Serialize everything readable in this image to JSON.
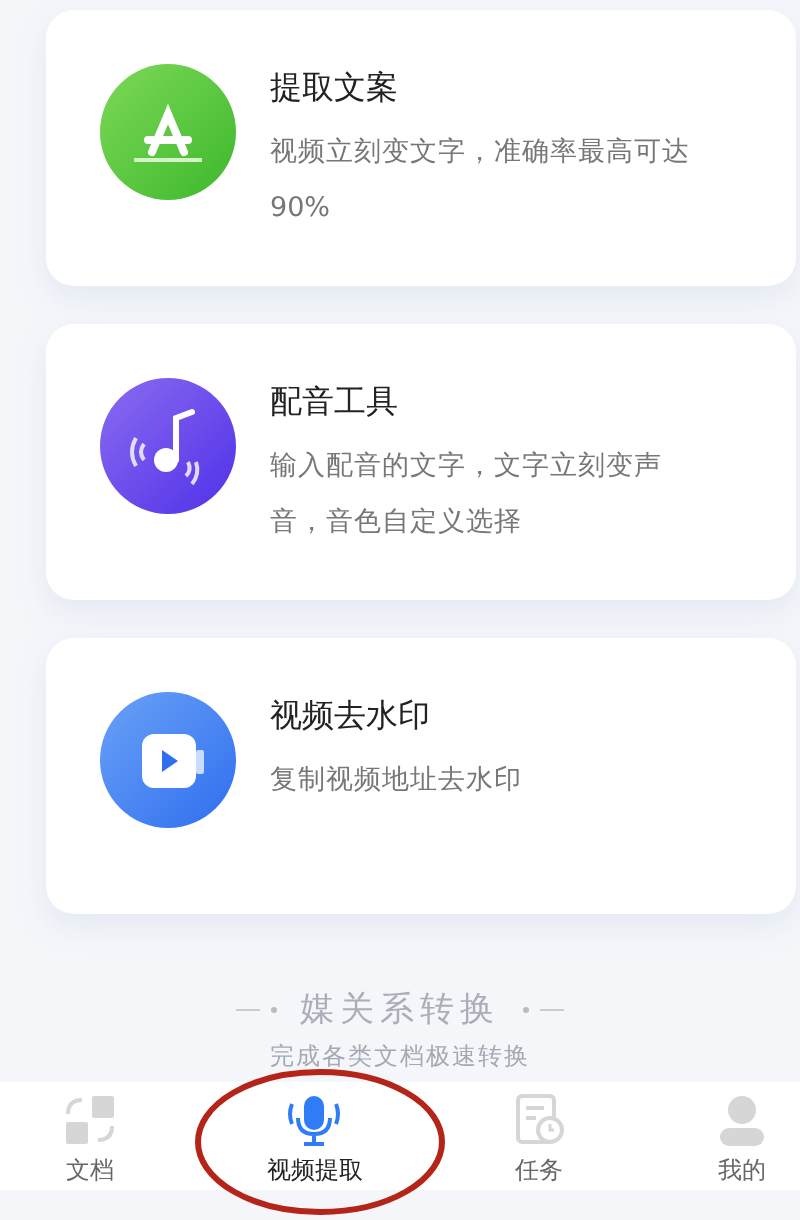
{
  "features": [
    {
      "kind": "text",
      "title": "提取文案",
      "description": "视频立刻变文字，准确率最高可达90%"
    },
    {
      "kind": "audio",
      "title": "配音工具",
      "description": "输入配音的文字，文字立刻变声音，音色自定义选择"
    },
    {
      "kind": "video",
      "title": "视频去水印",
      "description": "复制视频地址去水印"
    }
  ],
  "footer": {
    "title": "媒关系转换",
    "subtitle": "完成各类文档极速转换"
  },
  "tabs": [
    {
      "kind": "docs",
      "label": "文档",
      "selected": false
    },
    {
      "kind": "mic",
      "label": "视频提取",
      "selected": true
    },
    {
      "kind": "task",
      "label": "任务",
      "selected": false
    },
    {
      "kind": "user",
      "label": "我的",
      "selected": false
    }
  ]
}
